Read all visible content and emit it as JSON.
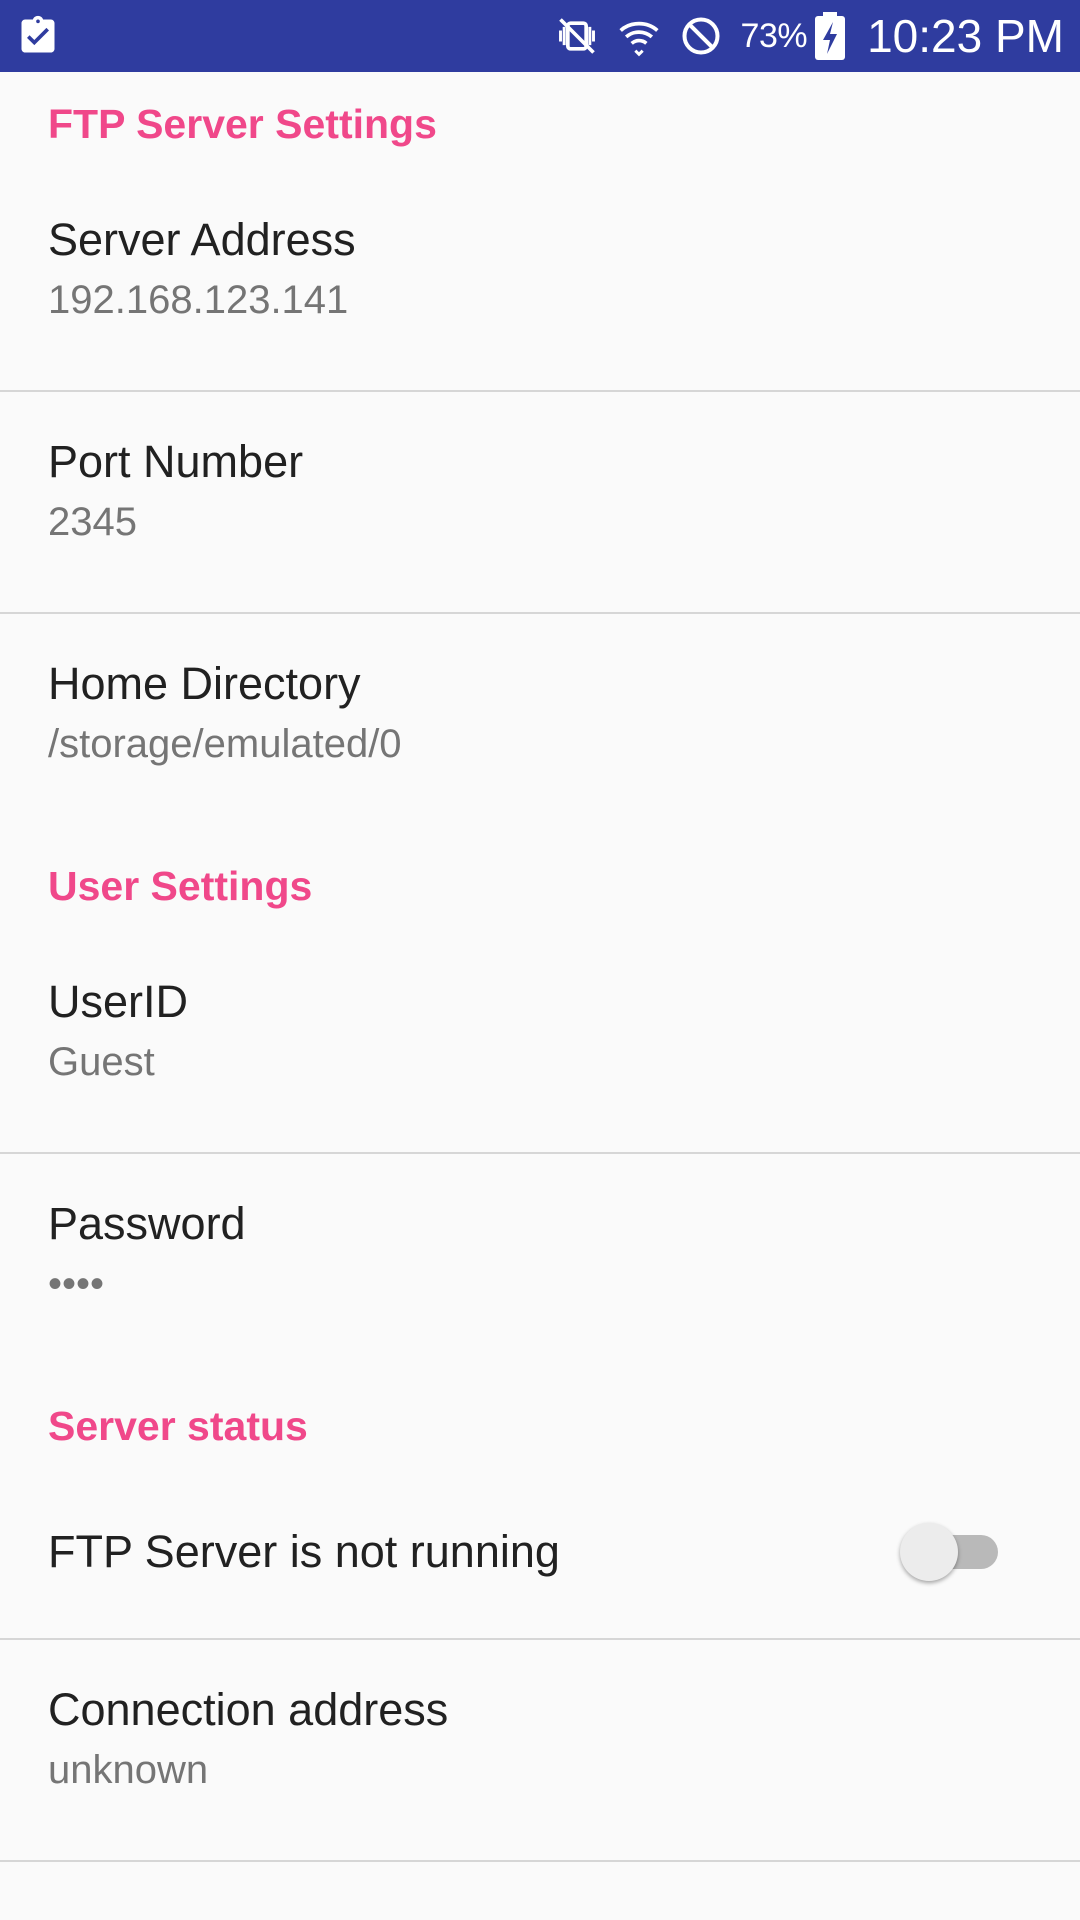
{
  "status_bar": {
    "battery_percent": "73%",
    "time": "10:23 PM",
    "icons": [
      "clipboard-check-icon",
      "vibrate-mute-icon",
      "wifi-icon",
      "do-not-disturb-icon",
      "battery-charging-icon"
    ],
    "background": "#2f3c9f"
  },
  "settings": {
    "ftp_category": "FTP Server Settings",
    "server_address": {
      "title": "Server Address",
      "summary": "192.168.123.141"
    },
    "port_number": {
      "title": "Port Number",
      "summary": "2345"
    },
    "home_directory": {
      "title": "Home Directory",
      "summary": "/storage/emulated/0"
    },
    "user_category": "User Settings",
    "user_id": {
      "title": "UserID",
      "summary": "Guest"
    },
    "password": {
      "title": "Password",
      "summary": "••••"
    },
    "status_category": "Server status",
    "server_toggle": {
      "title": "FTP Server is not running",
      "checked": false
    },
    "connection_address": {
      "title": "Connection address",
      "summary": "unknown"
    }
  },
  "colors": {
    "accent": "#f0488a",
    "primary_text": "#212121",
    "secondary_text": "#757575"
  }
}
